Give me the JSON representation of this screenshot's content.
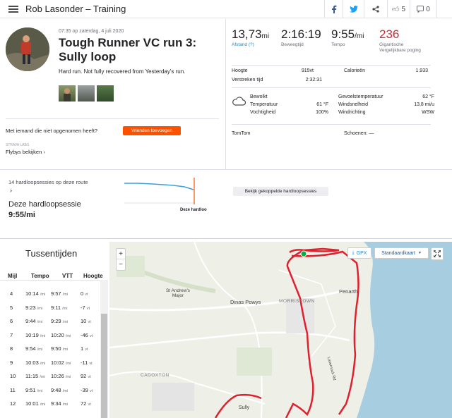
{
  "header": {
    "title": "Rob Lasonder – Training",
    "kudos_count": "5",
    "comments_count": "0"
  },
  "activity": {
    "date": "07:35 op zaterdag, 4 juli 2020",
    "title": "Tough Runner VC run 3: Sully loop",
    "description": "Hard run. Not fully recovered from Yesterday's run."
  },
  "stats": {
    "distance": {
      "value": "13,73",
      "unit": "mi",
      "label": "Afstand (?)"
    },
    "moving_time": {
      "value": "2:16:19",
      "label": "Beweegtijd"
    },
    "pace": {
      "value": "9:55",
      "unit": "/mi",
      "label": "Tempo"
    },
    "relative_effort": {
      "value": "236",
      "label": "Gigantische Vergelijkbare poging"
    },
    "elevation": {
      "label": "Hoogte",
      "value": "915vt"
    },
    "calories": {
      "label": "Calorieën",
      "value": "1.933"
    },
    "elapsed": {
      "label": "Verstreken tijd",
      "value": "2:32:31"
    }
  },
  "weather": {
    "condition": "Bewolkt",
    "temp_label": "Temperatuur",
    "temp": "61 °F",
    "humidity_label": "Vochtigheid",
    "humidity": "100%",
    "feels_label": "Gevoelstemperatuur",
    "feels": "62 °F",
    "wind_label": "Windsnelheid",
    "wind": "13,8 mi/u",
    "dir_label": "Windrichting",
    "dir": "WSW"
  },
  "device": "TomTom",
  "shoes": "Schoenen: —",
  "social": {
    "prompt": "Met iemand die niet opgenomen heeft?",
    "button": "Vrienden toevoegen",
    "labs": "STRAVA LABS",
    "flyby": "Flybys bekijken"
  },
  "route": {
    "count": "14 hardloopsessies op deze route",
    "session_label": "Deze hardloopsessie",
    "session_pace": "9:55/mi",
    "marker": "Deze hardloo",
    "button": "Bekijk gekoppelde hardloopsessies"
  },
  "splits": {
    "title": "Tussentijden",
    "headers": [
      "Mijl",
      "Tempo",
      "VTT",
      "Hoogte"
    ],
    "rows": [
      {
        "mile": "4",
        "pace": "10:14",
        "gap": "9:57",
        "elev": "0"
      },
      {
        "mile": "5",
        "pace": "9:23",
        "gap": "9:11",
        "elev": "-7"
      },
      {
        "mile": "6",
        "pace": "9:44",
        "gap": "9:29",
        "elev": "10"
      },
      {
        "mile": "7",
        "pace": "10:19",
        "gap": "10:20",
        "elev": "-46"
      },
      {
        "mile": "8",
        "pace": "9:54",
        "gap": "9:50",
        "elev": "1"
      },
      {
        "mile": "9",
        "pace": "10:03",
        "gap": "10:02",
        "elev": "-11"
      },
      {
        "mile": "10",
        "pace": "11:15",
        "gap": "10:26",
        "elev": "92"
      },
      {
        "mile": "11",
        "pace": "9:51",
        "gap": "9:48",
        "elev": "-39"
      },
      {
        "mile": "12",
        "pace": "10:01",
        "gap": "9:34",
        "elev": "72"
      }
    ],
    "pace_unit": "/mi",
    "elev_unit": "vt"
  },
  "map": {
    "gpx": "GPX",
    "style": "Standaardkaart",
    "labels": [
      "St Andrew's Major",
      "Dinas Powys",
      "MORRISTOWN",
      "Penarth",
      "CADOXTON",
      "Sully",
      "Lavernock Rd"
    ]
  },
  "colors": {
    "accent": "#fc5200",
    "route": "#e0202e",
    "link": "#1e88c8"
  }
}
